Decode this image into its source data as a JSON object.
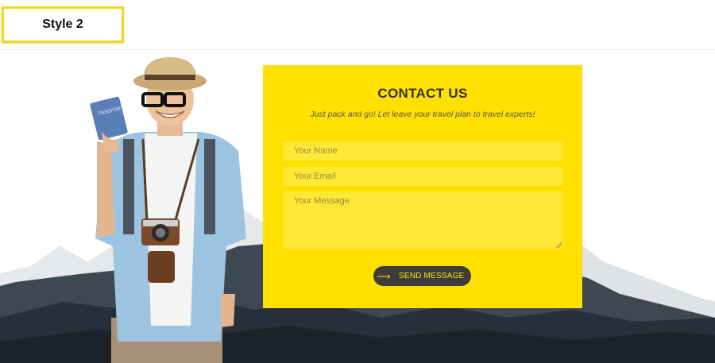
{
  "badge": {
    "label": "Style 2"
  },
  "contact": {
    "title": "CONTACT US",
    "subtitle": "Just pack and go! Let leave your travel plan to travel experts!",
    "fields": {
      "name_placeholder": "Your Name",
      "email_placeholder": "Your Email",
      "message_placeholder": "Your Message"
    },
    "send_label": "SEND MESSAGE",
    "send_icon": "arrow-right-icon"
  },
  "colors": {
    "accent": "#ffe000",
    "button_bg": "#3d3d3d",
    "text_dark": "#333333"
  },
  "images": {
    "background": "snowy-mountain-range",
    "person": "traveler-with-passport-and-camera",
    "passport_text": "PASSPORT"
  }
}
